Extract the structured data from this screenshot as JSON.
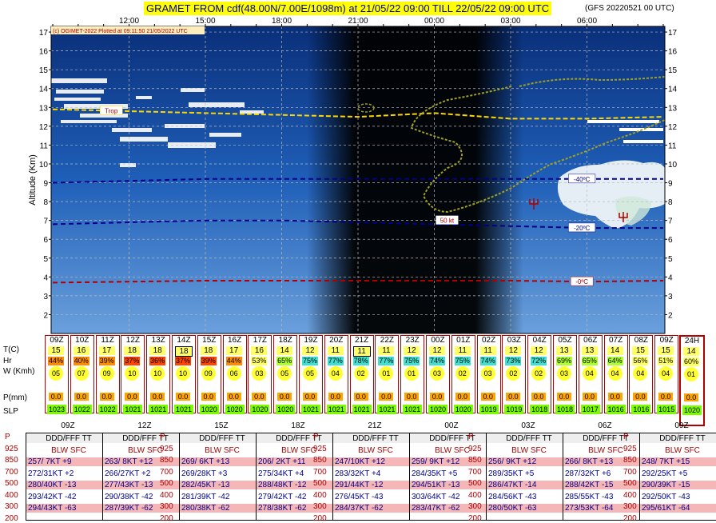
{
  "header": {
    "title": "GRAMET FROM cdf(48.00N/7.00E/1098m) at 21/05/22 09:00  TILL  22/05/22 09:00 UTC",
    "run": "(GFS 20220521 00 UTC)",
    "copyright": "(c) OGIMET-2022 Plotted at 09:11:50 21/05/2022 UTC"
  },
  "chart_data": {
    "type": "line",
    "title": "GRAMET FROM cdf(48.00N/7.00E/1098m) at 21/05/22 09:00  TILL  22/05/22 09:00 UTC",
    "ylabel": "Altitude (Km)",
    "xlabel": "",
    "ylim": [
      1,
      17.3
    ],
    "xlim_hours": [
      0,
      24
    ],
    "time_ticks": [
      {
        "label": "12:00",
        "h": 3
      },
      {
        "label": "15:00",
        "h": 6
      },
      {
        "label": "18:00",
        "h": 9
      },
      {
        "label": "21:00",
        "h": 12
      },
      {
        "label": "00:00",
        "h": 15
      },
      {
        "label": "03:00",
        "h": 18
      },
      {
        "label": "06:00",
        "h": 21
      }
    ],
    "y_ticks": [
      2,
      3,
      4,
      5,
      6,
      7,
      8,
      9,
      10,
      11,
      12,
      13,
      14,
      15,
      16,
      17
    ],
    "night_hours": [
      10,
      18.5
    ],
    "series": [
      {
        "name": "Trop",
        "color": "#ffd700",
        "x": [
          0,
          3,
          6,
          9,
          12,
          15,
          18,
          21,
          24
        ],
        "y": [
          12.9,
          12.8,
          12.7,
          12.6,
          12.5,
          12.7,
          12.4,
          12.4,
          12.5
        ]
      },
      {
        "name": "-40ºC",
        "color": "#00008b",
        "x": [
          0,
          3,
          6,
          9,
          12,
          15,
          18,
          21,
          24
        ],
        "y": [
          9.0,
          9.1,
          9.2,
          9.2,
          9.2,
          9.2,
          9.2,
          9.2,
          9.2
        ]
      },
      {
        "name": "-20ºC",
        "color": "#00008b",
        "x": [
          0,
          3,
          6,
          9,
          12,
          15,
          18,
          21,
          24
        ],
        "y": [
          6.8,
          6.9,
          7.0,
          7.0,
          6.9,
          6.8,
          6.7,
          6.6,
          6.6
        ]
      },
      {
        "name": "-0ºC",
        "color": "#b00000",
        "x": [
          0,
          3,
          6,
          9,
          12,
          15,
          18,
          21,
          24
        ],
        "y": [
          3.7,
          3.75,
          3.8,
          3.8,
          3.8,
          3.8,
          3.8,
          3.75,
          3.8
        ]
      }
    ],
    "annotations": [
      "Trop",
      "-40ºC",
      "-20ºC",
      "-0ºC",
      "50 kt"
    ]
  },
  "hours": [
    {
      "label": "09Z",
      "t": "15",
      "hr": "44%",
      "hrc": "#ff8c00",
      "w": "05",
      "p": "0.0",
      "slp": "1023"
    },
    {
      "label": "10Z",
      "t": "16",
      "hr": "40%",
      "hrc": "#ff8c00",
      "w": "07",
      "p": "0.0",
      "slp": "1022"
    },
    {
      "label": "11Z",
      "t": "17",
      "hr": "39%",
      "hrc": "#ff8c00",
      "w": "09",
      "p": "0.0",
      "slp": "1022"
    },
    {
      "label": "12Z",
      "t": "18",
      "hr": "37%",
      "hrc": "#ff4500",
      "w": "10",
      "p": "0.0",
      "slp": "1021"
    },
    {
      "label": "13Z",
      "t": "18",
      "hr": "36%",
      "hrc": "#ff4500",
      "w": "10",
      "p": "0.0",
      "slp": "1021"
    },
    {
      "label": "14Z",
      "t": "18",
      "hr": "37%",
      "hrc": "#ff4500",
      "w": "10",
      "p": "0.0",
      "slp": "1021"
    },
    {
      "label": "15Z",
      "t": "18",
      "hr": "39%",
      "hrc": "#ff4500",
      "w": "09",
      "p": "0.0",
      "slp": "1020"
    },
    {
      "label": "16Z",
      "t": "17",
      "hr": "44%",
      "hrc": "#ff8c00",
      "w": "06",
      "p": "0.0",
      "slp": "1020"
    },
    {
      "label": "17Z",
      "t": "16",
      "hr": "53%",
      "hrc": "#ffff66",
      "w": "03",
      "p": "0.0",
      "slp": "1020"
    },
    {
      "label": "18Z",
      "t": "14",
      "hr": "65%",
      "hrc": "#adff2f",
      "w": "05",
      "p": "0.0",
      "slp": "1020"
    },
    {
      "label": "19Z",
      "t": "12",
      "hr": "75%",
      "hrc": "#40e0d0",
      "w": "05",
      "p": "0.0",
      "slp": "1021"
    },
    {
      "label": "20Z",
      "t": "11",
      "hr": "77%",
      "hrc": "#40e0d0",
      "w": "04",
      "p": "0.0",
      "slp": "1021"
    },
    {
      "label": "21Z",
      "t": "11",
      "hr": "78%",
      "hrc": "#40e0d0",
      "w": "02",
      "p": "0.0",
      "slp": "1021"
    },
    {
      "label": "22Z",
      "t": "11",
      "hr": "77%",
      "hrc": "#40e0d0",
      "w": "01",
      "p": "0.0",
      "slp": "1021"
    },
    {
      "label": "23Z",
      "t": "12",
      "hr": "75%",
      "hrc": "#40e0d0",
      "w": "01",
      "p": "0.0",
      "slp": "1021"
    },
    {
      "label": "00Z",
      "t": "12",
      "hr": "74%",
      "hrc": "#40e0d0",
      "w": "03",
      "p": "0.0",
      "slp": "1020"
    },
    {
      "label": "01Z",
      "t": "11",
      "hr": "75%",
      "hrc": "#40e0d0",
      "w": "02",
      "p": "0.0",
      "slp": "1020"
    },
    {
      "label": "02Z",
      "t": "11",
      "hr": "74%",
      "hrc": "#40e0d0",
      "w": "03",
      "p": "0.0",
      "slp": "1019"
    },
    {
      "label": "03Z",
      "t": "12",
      "hr": "73%",
      "hrc": "#40e0d0",
      "w": "02",
      "p": "0.0",
      "slp": "1019"
    },
    {
      "label": "04Z",
      "t": "12",
      "hr": "72%",
      "hrc": "#40e0d0",
      "w": "02",
      "p": "0.0",
      "slp": "1018"
    },
    {
      "label": "05Z",
      "t": "13",
      "hr": "69%",
      "hrc": "#adff2f",
      "w": "03",
      "p": "0.0",
      "slp": "1018"
    },
    {
      "label": "06Z",
      "t": "13",
      "hr": "65%",
      "hrc": "#adff2f",
      "w": "04",
      "p": "0.0",
      "slp": "1017"
    },
    {
      "label": "07Z",
      "t": "14",
      "hr": "64%",
      "hrc": "#adff2f",
      "w": "04",
      "p": "0.0",
      "slp": "1016"
    },
    {
      "label": "08Z",
      "t": "15",
      "hr": "56%",
      "hrc": "#ffff66",
      "w": "04",
      "p": "0.0",
      "slp": "1016"
    },
    {
      "label": "09Z",
      "t": "15",
      "hr": "51%",
      "hrc": "#ffff66",
      "w": "04",
      "p": "0.0",
      "slp": "1015"
    },
    {
      "label": "24H",
      "t": "14",
      "hr": "60%",
      "hrc": "#ffff66",
      "w": "01",
      "p": "0.0",
      "slp": "1020"
    }
  ],
  "row_labels": {
    "t": "T(C)",
    "hr": "Hr",
    "w": "W (Kmh)",
    "p": "P(mm)",
    "slp": "SLP"
  },
  "sounding_header": "DDD/FFF TT",
  "sounding_sub": "BLW SFC",
  "pressure_levels": [
    "P",
    "925",
    "850",
    "700",
    "500",
    "400",
    "300",
    "200"
  ],
  "soundings": [
    {
      "time": "09Z",
      "rows": [
        "257/ 7KT +9",
        "272/31KT +2",
        "280/40KT -13",
        "293/42KT -42",
        "294/43KT -63"
      ]
    },
    {
      "time": "12Z",
      "rows": [
        "263/ 8KT +12",
        "266/27KT +2",
        "277/43KT -13",
        "290/38KT -42",
        "287/39KT -62"
      ]
    },
    {
      "time": "15Z",
      "rows": [
        "269/ 6KT +13",
        "269/28KT +3",
        "282/45KT -13",
        "281/39KT -42",
        "280/38KT -62"
      ]
    },
    {
      "time": "18Z",
      "rows": [
        "206/ 2KT +11",
        "275/34KT +4",
        "288/48KT -12",
        "279/42KT -42",
        "278/38KT -62"
      ]
    },
    {
      "time": "21Z",
      "rows": [
        "247/10KT +12",
        "283/32KT +4",
        "291/44KT -12",
        "276/45KT -43",
        "284/37KT -62"
      ]
    },
    {
      "time": "00Z",
      "rows": [
        "259/ 9KT +12",
        "284/35KT +5",
        "294/51KT -13",
        "303/64KT -42",
        "283/47KT -62"
      ]
    },
    {
      "time": "03Z",
      "rows": [
        "256/ 9KT +12",
        "289/35KT +5",
        "286/47KT -14",
        "284/56KT -43",
        "280/50KT -63"
      ]
    },
    {
      "time": "06Z",
      "rows": [
        "266/ 8KT +13",
        "287/32KT +6",
        "288/42KT -15",
        "285/55KT -43",
        "273/53KT -64"
      ]
    },
    {
      "time": "09Z",
      "rows": [
        "248/ 7KT +15",
        "292/25KT +5",
        "290/39KT -15",
        "292/50KT -43",
        "295/61KT -64"
      ]
    }
  ]
}
